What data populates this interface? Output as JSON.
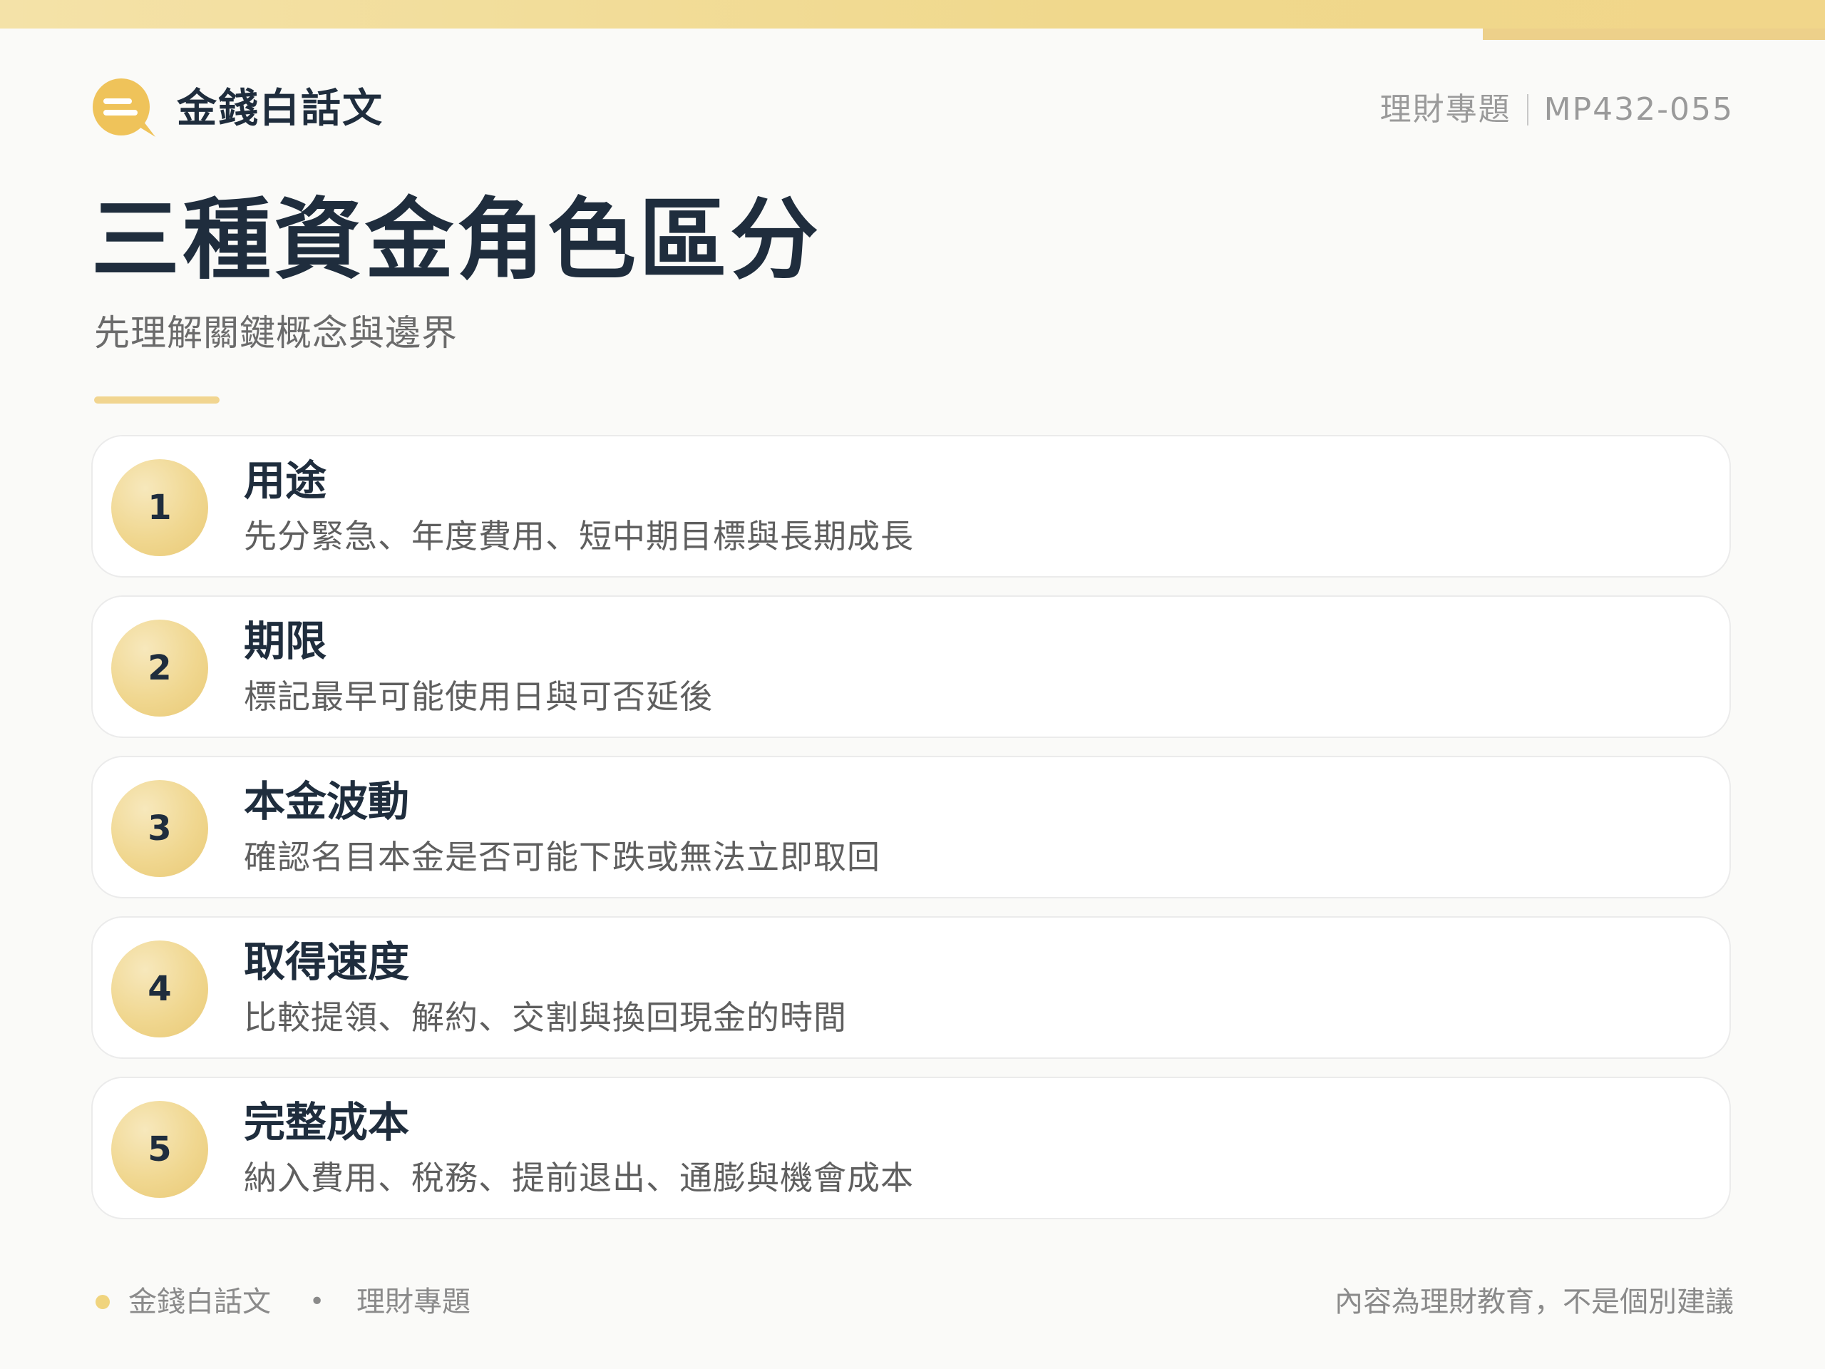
{
  "header": {
    "brand": "金錢白話文",
    "topic": "理財專題",
    "code": "MP432-055"
  },
  "page": {
    "title": "三種資金角色區分",
    "subtitle": "先理解關鍵概念與邊界"
  },
  "items": [
    {
      "number": "1",
      "title": "用途",
      "desc": "先分緊急、年度費用、短中期目標與長期成長"
    },
    {
      "number": "2",
      "title": "期限",
      "desc": "標記最早可能使用日與可否延後"
    },
    {
      "number": "3",
      "title": "本金波動",
      "desc": "確認名目本金是否可能下跌或無法立即取回"
    },
    {
      "number": "4",
      "title": "取得速度",
      "desc": "比較提領、解約、交割與換回現金的時間"
    },
    {
      "number": "5",
      "title": "完整成本",
      "desc": "納入費用、稅務、提前退出、通膨與機會成本"
    }
  ],
  "footer": {
    "brand": "金錢白話文",
    "separator": "•",
    "topic": "理財專題",
    "disclaimer": "內容為理財教育，不是個別建議"
  },
  "colors": {
    "accent": "#f0d590",
    "text_dark": "#1f2d3d",
    "text_muted": "#8a8a8a"
  },
  "icons": {
    "logo": "chat-bubble-icon"
  }
}
